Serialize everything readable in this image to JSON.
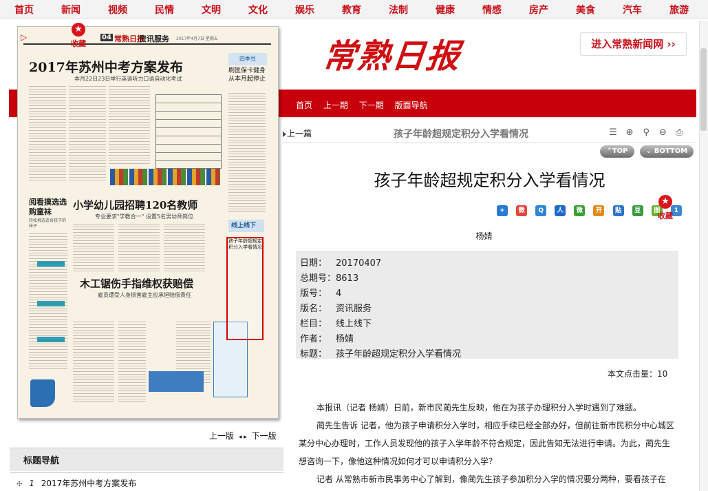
{
  "topnav": {
    "items": [
      "首页",
      "新闻",
      "视频",
      "民情",
      "文明",
      "文化",
      "娱乐",
      "教育",
      "法制",
      "健康",
      "情感",
      "房产",
      "美食",
      "汽车",
      "旅游"
    ]
  },
  "site": {
    "masthead": "常熟日报",
    "enter_label": "进入常熟新闻网 ››"
  },
  "redband": {
    "home": "首页",
    "prev_issue": "上一期",
    "next_issue": "下一期",
    "page_nav": "版面导航"
  },
  "newspaper": {
    "page_no": "04",
    "logo": "常熟日报",
    "section": "资讯服务",
    "dateline": "2017年4月7日 星期五",
    "headline1": "2017年苏州中考方案发布",
    "sub1": "本月22日23日举行英语听力口语自动化考试",
    "headline2": "小学幼儿园招聘120名教师",
    "sub2": "专业要求\"学教合一\"  设置5名男幼师岗位",
    "headline3": "木工锯伤手指维权获赔偿",
    "sub3": "雇员遭受人身损害雇主应承担赔偿责任",
    "side_head": "阅看摸选选购童袜",
    "side_sub": "轻松挑选适合孩子的袜子",
    "right_badge": "四季豆",
    "right_head": "刷医保卡健身从本月起停止",
    "line_tag": "线上线下",
    "highlight_title": "孩子年龄超规定积分入学看情况",
    "favorite": "收藏"
  },
  "pagenav": {
    "prev": "上一版",
    "next": "下一版"
  },
  "title_nav": {
    "label": "标题导航",
    "items": [
      {
        "num": "1",
        "title": "2017年苏州中考方案发布"
      }
    ]
  },
  "article_bar": {
    "prev_piece": "上一篇",
    "title": "孩子年龄超规定积分入学看情况",
    "tools": [
      "list-icon",
      "zoom-in-icon",
      "zoom-icon",
      "zoom-out-icon",
      "print-icon"
    ]
  },
  "scroll_buttons": {
    "top": "TOP",
    "bottom": "BOTTOM"
  },
  "article": {
    "title": "孩子年龄超规定积分入学看情况",
    "author": "杨婧",
    "favorite": "收藏",
    "share_icons": [
      "plus",
      "weibo",
      "qzone",
      "renren",
      "wechat",
      "douban",
      "kaixin",
      "tieba",
      "weibo2",
      "one"
    ],
    "info": [
      {
        "k": "日期：",
        "v": "20170407"
      },
      {
        "k": "总期号：",
        "v": "8613"
      },
      {
        "k": "版号：",
        "v": "4"
      },
      {
        "k": "版名：",
        "v": "资讯服务"
      },
      {
        "k": "栏目：",
        "v": "线上线下"
      },
      {
        "k": "作者：",
        "v": "杨婧"
      },
      {
        "k": "标题：",
        "v": "孩子年龄超规定积分入学看情况"
      }
    ],
    "hits_label": "本文点击量：",
    "hits": "10",
    "paragraphs": [
      "本报讯（记者 杨婧）日前，新市民蔺先生反映，他在为孩子办理积分入学时遇到了难题。",
      "蔺先生告诉 记者，他为孩子申请积分入学时，相应手续已经全部办好，但前往新市民积分中心城区某分中心办理时，工作人员发现他的孩子入学年龄不符合规定，因此告知无法进行申请。为此，蔺先生想咨询一下，像他这种情况如何才可以申请积分入学？",
      "记者 从常熟市新市民事务中心了解到，像蔺先生孩子参加积分入学的情况要分两种，要看孩子在"
    ]
  },
  "colors": {
    "brand_red": "#c7000b",
    "nav_red": "#c8101a"
  }
}
